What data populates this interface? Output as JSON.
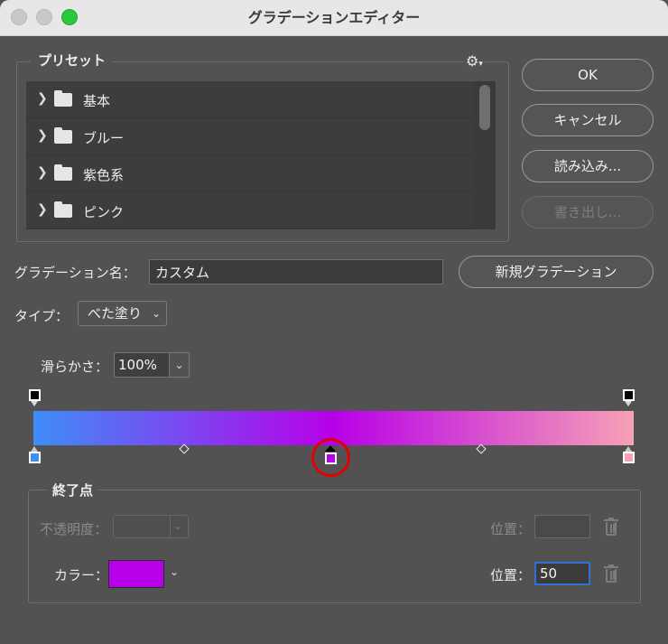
{
  "window": {
    "title": "グラデーションエディター"
  },
  "presets": {
    "legend": "プリセット",
    "gear_icon": "gear-icon",
    "items": [
      {
        "label": "基本"
      },
      {
        "label": "ブルー"
      },
      {
        "label": "紫色系"
      },
      {
        "label": "ピンク"
      }
    ]
  },
  "buttons": {
    "ok": "OK",
    "cancel": "キャンセル",
    "load": "読み込み...",
    "export": "書き出し...",
    "new_gradient": "新規グラデーション"
  },
  "name": {
    "label": "グラデーション名：",
    "value": "カスタム"
  },
  "type": {
    "label": "タイプ：",
    "value": "べた塗り"
  },
  "smoothness": {
    "label": "滑らかさ：",
    "value": "100%"
  },
  "gradient": {
    "color_stops": [
      {
        "position": 0,
        "color": "#3f8df8"
      },
      {
        "position": 50,
        "color": "#b800e8"
      },
      {
        "position": 100,
        "color": "#f7a1b6"
      }
    ],
    "opacity_stops": [
      {
        "position": 0,
        "color": "#000000"
      },
      {
        "position": 100,
        "color": "#000000"
      }
    ],
    "midpoints": [
      25,
      75
    ],
    "selected_stop": 50
  },
  "stops": {
    "legend": "終了点",
    "opacity_label": "不透明度：",
    "opacity_value": "",
    "location_label": "位置：",
    "opacity_location_value": "",
    "color_label": "カラー：",
    "color_value": "#b800e8",
    "color_location_label": "位置：",
    "color_location_value": "50"
  }
}
